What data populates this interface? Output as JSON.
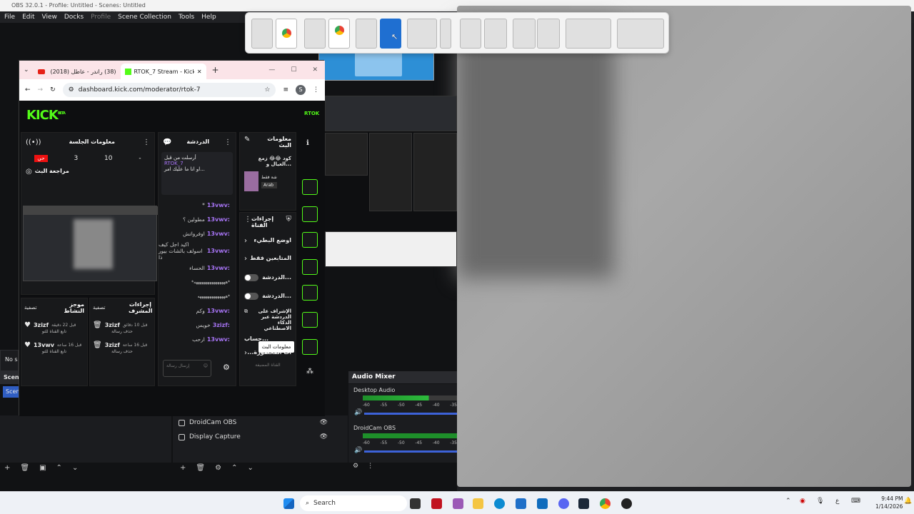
{
  "obs": {
    "title": "OBS 32.0.1 - Profile: Untitled - Scenes: Untitled",
    "menu": [
      "File",
      "Edit",
      "View",
      "Docks",
      "Profile",
      "Scene Collection",
      "Tools",
      "Help"
    ],
    "scenes_label": "Scen",
    "scene_item": "Scen",
    "no_source": "No s",
    "sources": [
      "DroidCam OBS",
      "Display Capture"
    ],
    "mixer": {
      "title": "Audio Mixer",
      "channels": [
        {
          "name": "Desktop Audio",
          "ticks": [
            "-60",
            "-55",
            "-50",
            "-45",
            "-40",
            "-35"
          ]
        },
        {
          "name": "DroidCam OBS",
          "ticks": [
            "-60",
            "-55",
            "-50",
            "-45",
            "-40",
            "-35"
          ]
        }
      ]
    }
  },
  "chrome": {
    "tabs": [
      {
        "label": "(38) راندر - عاطل (2018)",
        "icon": "youtube-icon"
      },
      {
        "label": "RTOK_7 Stream - Kick",
        "icon": "kick-icon"
      }
    ],
    "url": "dashboard.kick.com/moderator/rtok-7",
    "profile_initial": "S"
  },
  "kick": {
    "logo": "KICK",
    "beta": "BETA",
    "channel_badge": "RTOK",
    "session_info": {
      "title": "معلومات الجلسة",
      "live": "حي",
      "stats": [
        "3",
        "10",
        "-"
      ],
      "review": "مراجعة البث"
    },
    "chat": {
      "title": "الدردشة",
      "pinned_by": "أرسلت من قبل",
      "pinned_user": "RTOK_7",
      "pinned_text": "او انا ما عليك امر...",
      "messages": [
        {
          "user": "13vwv:",
          "text": "*"
        },
        {
          "user": "13vwv:",
          "text": "مطولين ؟"
        },
        {
          "user": "13vwv:",
          "text": "اوفرواتش"
        },
        {
          "user": "13vwv:",
          "text": "اكيد اجل كيف اسولف بالشات بيور ذا"
        },
        {
          "user": "13vwv:",
          "text": "الحساء"
        },
        {
          "user": "",
          "text": "*ههههههههههههههههه*"
        },
        {
          "user": "",
          "text": "ههههههههههههههه*"
        },
        {
          "user": "13vwv:",
          "text": "وكم"
        },
        {
          "user": "3zizf:",
          "text": "خويس"
        },
        {
          "user": "13vwv:",
          "text": "ارحب"
        }
      ],
      "input_placeholder": "إرسال رسالة"
    },
    "stream_info": {
      "title": "معلومات البث",
      "stream_title": "كود 😂😂 زمع العيال و...",
      "category": "شة فقط",
      "language": "Arab"
    },
    "channel_actions": {
      "title": "إجراءات القناة",
      "items": [
        "اوضع البطيء",
        "المتابعين فقط",
        "الدردشة...",
        "الدردشة...",
        "الإشراف على الدردشة عبر الذكاء الاصطناعي",
        "حساب...",
        "...ات المحظورة"
      ],
      "footer": "القناة المضيفة"
    },
    "mod_actions": {
      "title": "إجراءات المشرف",
      "filter": "تصفية",
      "entries": [
        {
          "user": "3zizf",
          "time": "قبل 10 دقائق",
          "action": "حذف رسالة"
        },
        {
          "user": "3zizf",
          "time": "قبل 16 ساعة",
          "action": "حذف رسالة"
        }
      ]
    },
    "activity": {
      "title": "موجز النشاط",
      "filter": "تصفية",
      "entries": [
        {
          "user": "3zizf",
          "time": "قبل 22 دقيقة",
          "action": "تابع القناة للتو"
        },
        {
          "user": "13vwv",
          "time": "قبل 16 ساعة",
          "action": "تابع القناة للتو"
        }
      ]
    },
    "tooltip": "معلومات البث"
  },
  "taskbar": {
    "search": "Search",
    "time": "9:44 PM",
    "date": "1/14/2026",
    "ime": "ع"
  },
  "colors": {
    "kick_green": "#53fc18",
    "chat_user": "#a774f5",
    "obs_bg": "#1e1f22"
  }
}
